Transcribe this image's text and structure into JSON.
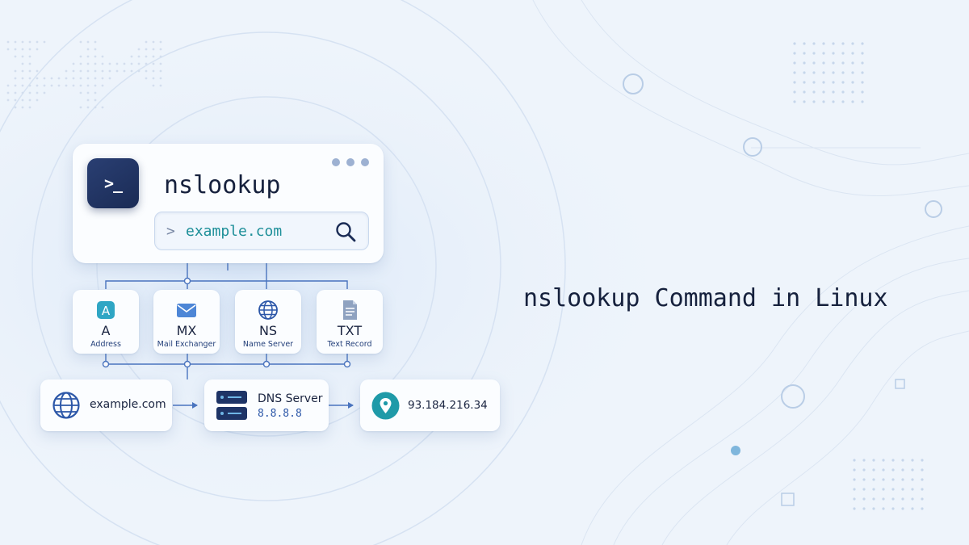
{
  "main": {
    "prompt_symbol": ">_",
    "command": "nslookup",
    "query_prompt": ">",
    "query": "example.com"
  },
  "records": [
    {
      "type": "A",
      "desc": "Address",
      "icon": "a-record-icon"
    },
    {
      "type": "MX",
      "desc": "Mail Exchanger",
      "icon": "mail-icon"
    },
    {
      "type": "NS",
      "desc": "Name Server",
      "icon": "globe-icon"
    },
    {
      "type": "TXT",
      "desc": "Text Record",
      "icon": "document-icon"
    }
  ],
  "flow": {
    "domain": "example.com",
    "server_label": "DNS Server",
    "server_ip": "8.8.8.8",
    "result_ip": "93.184.216.34"
  },
  "headline": "nslookup Command in Linux",
  "colors": {
    "accent": "#2c57a8",
    "dark": "#1a2b55",
    "teal": "#1e8f99",
    "background": "#eef4fb"
  }
}
